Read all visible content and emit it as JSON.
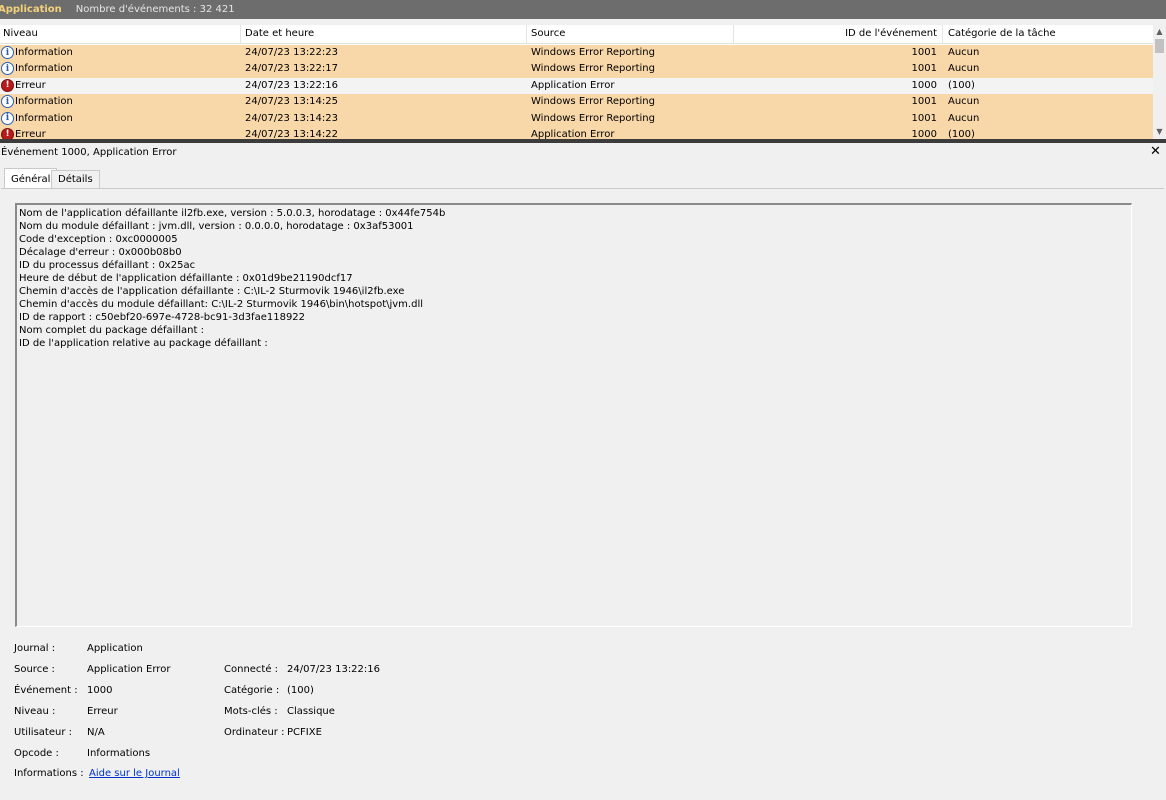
{
  "header": {
    "log_name": "Application",
    "event_count": "Nombre d'événements : 32 421"
  },
  "grid": {
    "columns": [
      "Niveau",
      "Date et heure",
      "Source",
      "ID de l'événement",
      "Catégorie de la tâche"
    ],
    "rows": [
      {
        "level": "Information",
        "date": "24/07/23 13:22:23",
        "source": "Windows Error Reporting",
        "id": "1001",
        "category": "Aucun",
        "kind": "info"
      },
      {
        "level": "Information",
        "date": "24/07/23 13:22:17",
        "source": "Windows Error Reporting",
        "id": "1001",
        "category": "Aucun",
        "kind": "info"
      },
      {
        "level": "Erreur",
        "date": "24/07/23 13:22:16",
        "source": "Application Error",
        "id": "1000",
        "category": "(100)",
        "kind": "err"
      },
      {
        "level": "Information",
        "date": "24/07/23 13:14:25",
        "source": "Windows Error Reporting",
        "id": "1001",
        "category": "Aucun",
        "kind": "info"
      },
      {
        "level": "Information",
        "date": "24/07/23 13:14:23",
        "source": "Windows Error Reporting",
        "id": "1001",
        "category": "Aucun",
        "kind": "info"
      },
      {
        "level": "Erreur",
        "date": "24/07/23 13:14:22",
        "source": "Application Error",
        "id": "1000",
        "category": "(100)",
        "kind": "err"
      }
    ]
  },
  "detail": {
    "title": "Événement 1000, Application Error",
    "close_glyph": "✕",
    "tabs": [
      "Général",
      "Détails"
    ],
    "message_lines": [
      "Nom de l'application défaillante il2fb.exe, version : 5.0.0.3, horodatage : 0x44fe754b",
      "Nom du module défaillant : jvm.dll, version : 0.0.0.0, horodatage : 0x3af53001",
      "Code d'exception : 0xc0000005",
      "Décalage d'erreur : 0x000b08b0",
      "ID du processus défaillant : 0x25ac",
      "Heure de début de l'application défaillante : 0x01d9be21190dcf17",
      "Chemin d'accès de l'application défaillante : C:\\IL-2 Sturmovik 1946\\il2fb.exe",
      "Chemin d'accès du module défaillant: C:\\IL-2 Sturmovik 1946\\bin\\hotspot\\jvm.dll",
      "ID de rapport : c50ebf20-697e-4728-bc91-3d3fae118922",
      "Nom complet du package défaillant :",
      "ID de l'application relative au package défaillant :"
    ],
    "props": {
      "journal_label": "Journal :",
      "journal_value": "Application",
      "source_label": "Source :",
      "source_value": "Application Error",
      "event_label": "Événement :",
      "event_value": "1000",
      "level_label": "Niveau :",
      "level_value": "Erreur",
      "user_label": "Utilisateur :",
      "user_value": "N/A",
      "opcode_label": "Opcode :",
      "opcode_value": "Informations",
      "info_label": "Informations :",
      "info_link": "Aide sur le Journal",
      "logged_label": "Connecté :",
      "logged_value": "24/07/23 13:22:16",
      "category_label": "Catégorie :",
      "category_value": "(100)",
      "keywords_label": "Mots-clés :",
      "keywords_value": "Classique",
      "computer_label": "Ordinateur :",
      "computer_value": "PCFIXE"
    }
  },
  "colors": {
    "info_row": "#f8d7a8",
    "error_row": "#f3f3f3",
    "titlebar": "#6d6d6d",
    "link": "#0033cc"
  }
}
